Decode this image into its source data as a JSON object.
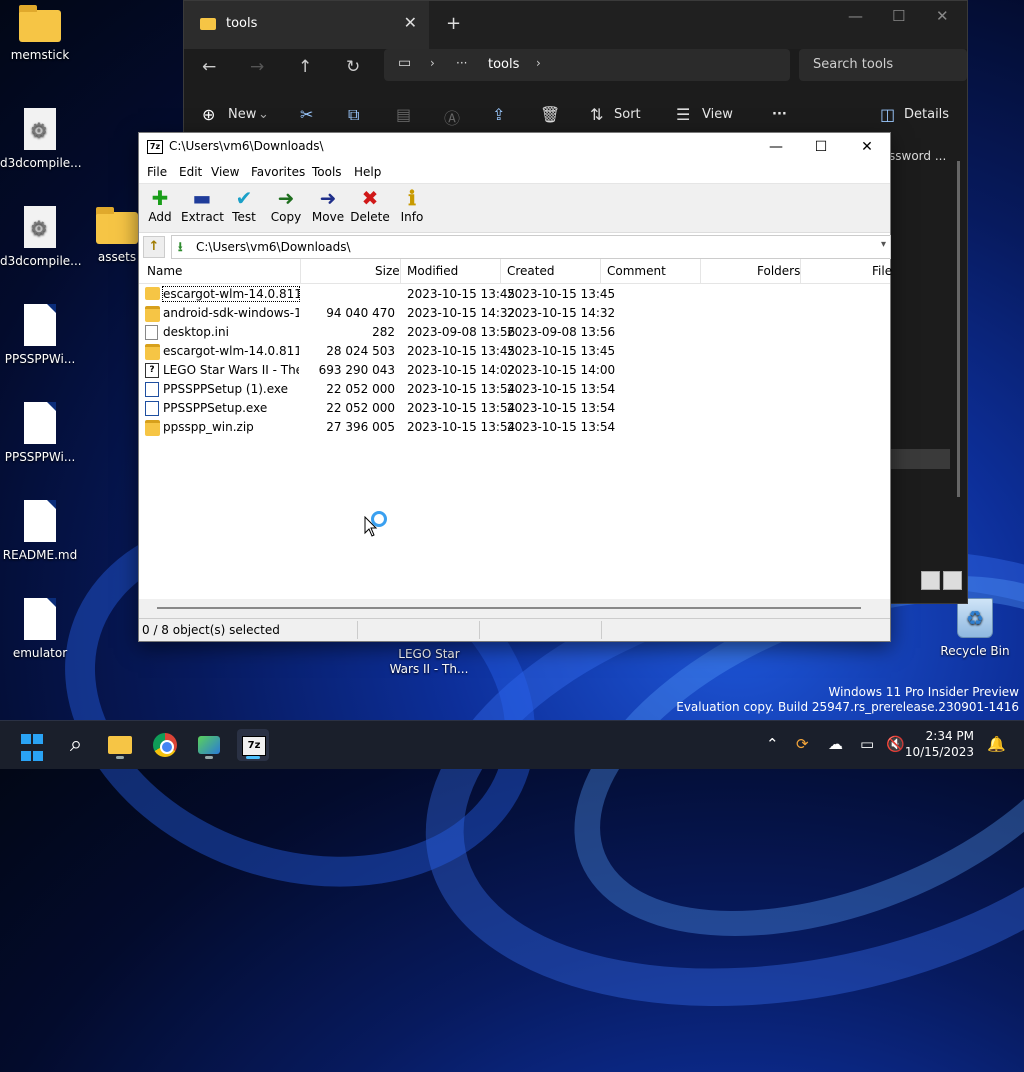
{
  "desktop": {
    "icons": [
      {
        "label": "memstick"
      },
      {
        "label": "d3dcompile..."
      },
      {
        "label": "d3dcompile..."
      },
      {
        "label": "assets"
      },
      {
        "label": "PPSSPPWi..."
      },
      {
        "label": "PPSSPPWi..."
      },
      {
        "label": "README.md"
      },
      {
        "label": "emulator"
      },
      {
        "label": "LEGO Star\nWars II - Th..."
      },
      {
        "label": "Recycle Bin"
      }
    ],
    "lego_label_1": "LEGO Star",
    "lego_label_2": "Wars II - Th..."
  },
  "explorer": {
    "tab_title": "tools",
    "breadcrumb_more": "···",
    "breadcrumb": "tools",
    "search_placeholder": "Search tools",
    "cmd": {
      "new": "New",
      "sort": "Sort",
      "view": "View",
      "more": "···",
      "details": "Details"
    },
    "side_text": "ssword ..."
  },
  "zip": {
    "title": "C:\\Users\\vm6\\Downloads\\",
    "menu": [
      "File",
      "Edit",
      "View",
      "Favorites",
      "Tools",
      "Help"
    ],
    "toolbar": [
      {
        "label": "Add",
        "icon": "plus-icon",
        "glyph": "+",
        "color": "#1a9e1a"
      },
      {
        "label": "Extract",
        "icon": "minus-icon",
        "glyph": "—",
        "color": "#1f3c9a"
      },
      {
        "label": "Test",
        "icon": "check-icon",
        "glyph": "✓",
        "color": "#1aa0c8"
      },
      {
        "label": "Copy",
        "icon": "arrow-right-icon",
        "glyph": "➜",
        "color": "#1e6e1e"
      },
      {
        "label": "Move",
        "icon": "arrow-right-icon",
        "glyph": "➜",
        "color": "#1f2f8a"
      },
      {
        "label": "Delete",
        "icon": "x-icon",
        "glyph": "✖",
        "color": "#d01818"
      },
      {
        "label": "Info",
        "icon": "info-icon",
        "glyph": "i",
        "color": "#c89a00"
      }
    ],
    "path": "C:\\Users\\vm6\\Downloads\\",
    "columns": [
      "Name",
      "Size",
      "Modified",
      "Created",
      "Comment",
      "Folders",
      "File"
    ],
    "rows": [
      {
        "name": "escargot-wlm-14.0.8117...",
        "size": "",
        "modified": "2023-10-15 13:45",
        "created": "2023-10-15 13:45",
        "type": "folder"
      },
      {
        "name": "android-sdk-windows-1...",
        "size": "94 040 470",
        "modified": "2023-10-15 14:32",
        "created": "2023-10-15 14:32",
        "type": "zip"
      },
      {
        "name": "desktop.ini",
        "size": "282",
        "modified": "2023-09-08 13:56",
        "created": "2023-09-08 13:56",
        "type": "ini"
      },
      {
        "name": "escargot-wlm-14.0.8117...",
        "size": "28 024 503",
        "modified": "2023-10-15 13:45",
        "created": "2023-10-15 13:45",
        "type": "zip"
      },
      {
        "name": "LEGO Star Wars II - The ...",
        "size": "693 290 043",
        "modified": "2023-10-15 14:02",
        "created": "2023-10-15 14:00",
        "type": "lego"
      },
      {
        "name": "PPSSPPSetup (1).exe",
        "size": "22 052 000",
        "modified": "2023-10-15 13:54",
        "created": "2023-10-15 13:54",
        "type": "exe"
      },
      {
        "name": "PPSSPPSetup.exe",
        "size": "22 052 000",
        "modified": "2023-10-15 13:54",
        "created": "2023-10-15 13:54",
        "type": "exe"
      },
      {
        "name": "ppsspp_win.zip",
        "size": "27 396 005",
        "modified": "2023-10-15 13:54",
        "created": "2023-10-15 13:54",
        "type": "zip"
      }
    ],
    "status": "0 / 8 object(s) selected"
  },
  "watermark": {
    "line1": "Windows 11 Pro Insider Preview",
    "line2": "Evaluation copy. Build 25947.rs_prerelease.230901-1416"
  },
  "taskbar": {
    "time": "2:34 PM",
    "date": "10/15/2023"
  }
}
